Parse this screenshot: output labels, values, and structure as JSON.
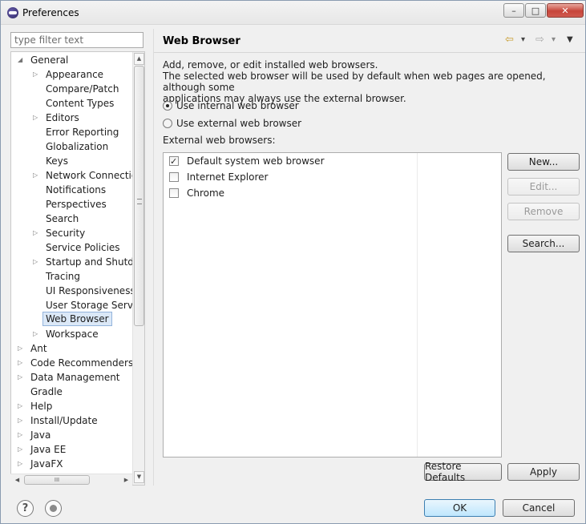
{
  "window": {
    "title": "Preferences",
    "controls": {
      "minimize": "–",
      "maximize": "□",
      "close": "✕"
    }
  },
  "filter": {
    "placeholder": "type filter text"
  },
  "tree": {
    "items": [
      {
        "label": "General",
        "twisty": "◢"
      },
      {
        "label": "Appearance",
        "twisty": "▷"
      },
      {
        "label": "Compare/Patch",
        "twisty": ""
      },
      {
        "label": "Content Types",
        "twisty": ""
      },
      {
        "label": "Editors",
        "twisty": "▷"
      },
      {
        "label": "Error Reporting",
        "twisty": ""
      },
      {
        "label": "Globalization",
        "twisty": ""
      },
      {
        "label": "Keys",
        "twisty": ""
      },
      {
        "label": "Network Connectio",
        "twisty": "▷"
      },
      {
        "label": "Notifications",
        "twisty": ""
      },
      {
        "label": "Perspectives",
        "twisty": ""
      },
      {
        "label": "Search",
        "twisty": ""
      },
      {
        "label": "Security",
        "twisty": "▷"
      },
      {
        "label": "Service Policies",
        "twisty": ""
      },
      {
        "label": "Startup and Shutdo",
        "twisty": "▷"
      },
      {
        "label": "Tracing",
        "twisty": ""
      },
      {
        "label": "UI Responsiveness M",
        "twisty": ""
      },
      {
        "label": "User Storage Servic",
        "twisty": ""
      },
      {
        "label": "Web Browser",
        "twisty": ""
      },
      {
        "label": "Workspace",
        "twisty": "▷"
      },
      {
        "label": "Ant",
        "twisty": "▷"
      },
      {
        "label": "Code Recommenders",
        "twisty": "▷"
      },
      {
        "label": "Data Management",
        "twisty": "▷"
      },
      {
        "label": "Gradle",
        "twisty": ""
      },
      {
        "label": "Help",
        "twisty": "▷"
      },
      {
        "label": "Install/Update",
        "twisty": "▷"
      },
      {
        "label": "Java",
        "twisty": "▷"
      },
      {
        "label": "Java EE",
        "twisty": "▷"
      },
      {
        "label": "JavaFX",
        "twisty": "▷"
      }
    ],
    "scroll": {
      "up": "▲",
      "down": "▼",
      "left": "◀",
      "right": "▶",
      "grip": "III"
    }
  },
  "page": {
    "title": "Web Browser",
    "nav": {
      "back": "⇦",
      "back_menu": "▾",
      "forward": "⇨",
      "forward_menu": "▾",
      "view_menu": "▼"
    },
    "description": [
      "Add, remove, or edit installed web browsers.",
      "The selected web browser will be used by default when web pages are opened, although some",
      "applications may always use the external browser."
    ],
    "radio_internal": "Use internal web browser",
    "radio_external": "Use external web browser",
    "external_label": "External web browsers:",
    "browsers": [
      {
        "name": "Default system web browser",
        "checked": true
      },
      {
        "name": "Internet Explorer",
        "checked": false
      },
      {
        "name": "Chrome",
        "checked": false
      }
    ],
    "buttons": {
      "new": "New...",
      "edit": "Edit...",
      "remove": "Remove",
      "search": "Search...",
      "restore_defaults": "Restore Defaults",
      "apply": "Apply"
    }
  },
  "footer": {
    "help_icon": "?",
    "ok": "OK",
    "cancel": "Cancel"
  }
}
